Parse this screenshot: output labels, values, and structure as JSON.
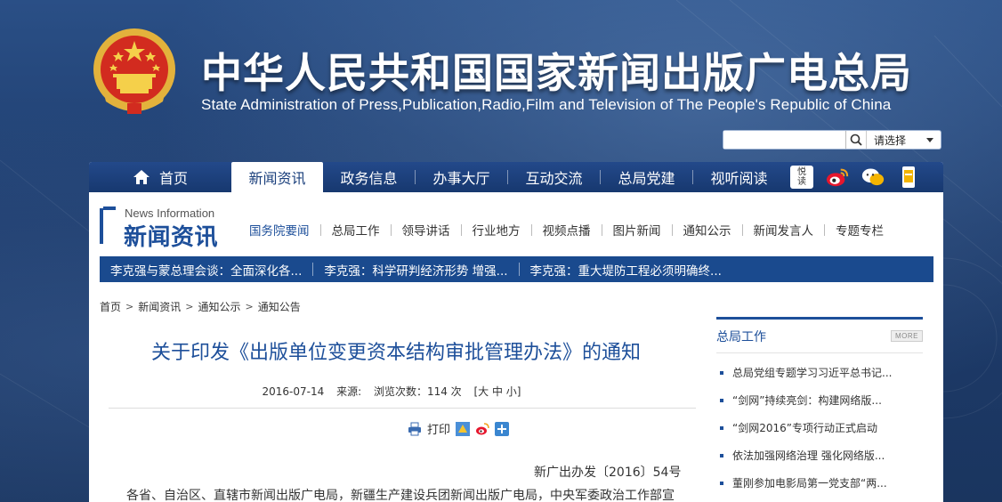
{
  "header": {
    "title_cn": "中华人民共和国国家新闻出版广电总局",
    "title_en": "State Administration of Press,Publication,Radio,Film and Television of The People's Republic of China"
  },
  "search": {
    "placeholder": "",
    "select_value": "请选择"
  },
  "nav": {
    "home": "首页",
    "items": [
      "新闻资讯",
      "政务信息",
      "办事大厅",
      "互动交流",
      "总局党建",
      "视听阅读"
    ],
    "active_index": 0,
    "icon_yuedu_text": "悦读"
  },
  "section": {
    "en": "News Information",
    "cn": "新闻资讯",
    "sub_items": [
      "国务院要闻",
      "总局工作",
      "领导讲话",
      "行业地方",
      "视频点播",
      "图片新闻",
      "通知公示",
      "新闻发言人",
      "专题专栏"
    ]
  },
  "ticker": {
    "items": [
      "李克强与蒙总理会谈：全面深化各...",
      "李克强：科学研判经济形势 增强...",
      "李克强：重大堤防工程必须明确终..."
    ]
  },
  "breadcrumb": [
    "首页",
    "新闻资讯",
    "通知公示",
    "通知公告"
  ],
  "article": {
    "title": "关于印发《出版单位变更资本结构审批管理办法》的通知",
    "date": "2016-07-14",
    "source_label": "来源:",
    "views": "浏览次数：114 次",
    "font_size_ctrl": "[大 中 小]",
    "print_label": "打印",
    "doc_number": "新广出办发〔2016〕54号",
    "body_first_line": "各省、自治区、直辖市新闻出版广电局，新疆生产建设兵团新闻出版广电局，中央军委政治工作部宣"
  },
  "side": {
    "title": "总局工作",
    "more_label": "MORE",
    "items": [
      "总局党组专题学习习近平总书记...",
      "“剑网”持续亮剑：构建网络版...",
      "“剑网2016”专项行动正式启动",
      "依法加强网络治理 强化网络版...",
      "董刚参加电影局第一党支部“两..."
    ]
  },
  "colors": {
    "brand_blue": "#1d4f9a",
    "nav_blue": "#17386f",
    "header_bg": "#1e3c6c"
  }
}
